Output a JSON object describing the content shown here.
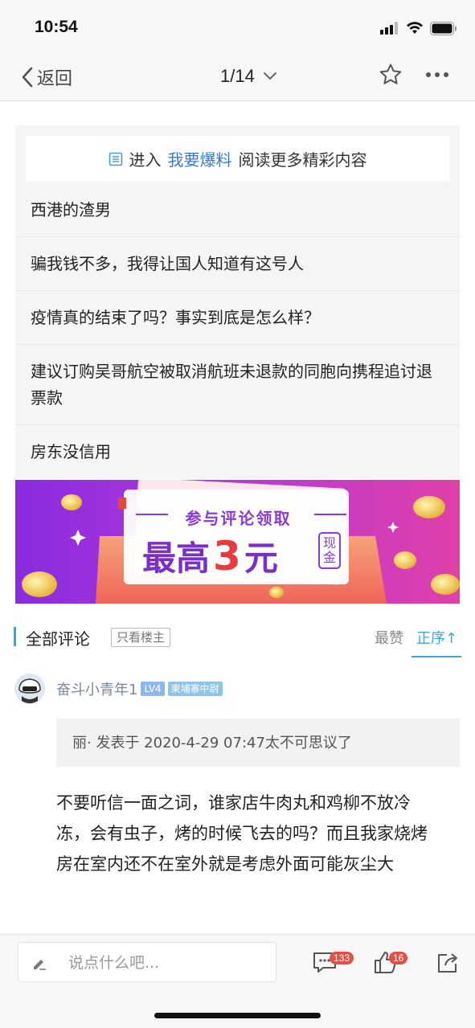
{
  "status": {
    "time": "10:54"
  },
  "nav": {
    "back_label": "返回",
    "page_indicator": "1/14"
  },
  "promo": {
    "prefix": "进入",
    "link": "我要爆料",
    "suffix": "阅读更多精彩内容"
  },
  "articles": [
    "西港的渣男",
    "骗我钱不多，我得让国人知道有这号人",
    "疫情真的结束了吗？事实到底是怎么样？",
    "建议订购吴哥航空被取消航班未退款的同胞向携程追讨退票款",
    "房东没信用"
  ],
  "ad": {
    "top_text": "参与评论领取",
    "main_prefix": "最高",
    "main_number": "3",
    "main_suffix": "元",
    "tag": "现金"
  },
  "comments_header": {
    "title": "全部评论",
    "filter_label": "只看楼主",
    "sort_hot": "最赞",
    "sort_order": "正序↑"
  },
  "comment": {
    "user": "奋斗小青年1",
    "level": "LV4",
    "title_badge": "柬埔寨中尉",
    "quote": "丽· 发表于 2020-4-29 07:47太不可思议了",
    "body": "不要听信一面之词，谁家店牛肉丸和鸡柳不放冷冻，会有虫子，烤的时候飞去的吗？而且我家烧烤房在室内还不在室外就是考虑外面可能灰尘大"
  },
  "bottom": {
    "input_placeholder": "说点什么吧...",
    "comment_count": "133",
    "like_count": "16"
  },
  "colors": {
    "accent": "#3aa8e0",
    "link": "#3a7bc8",
    "badge_red": "#e2504a"
  }
}
